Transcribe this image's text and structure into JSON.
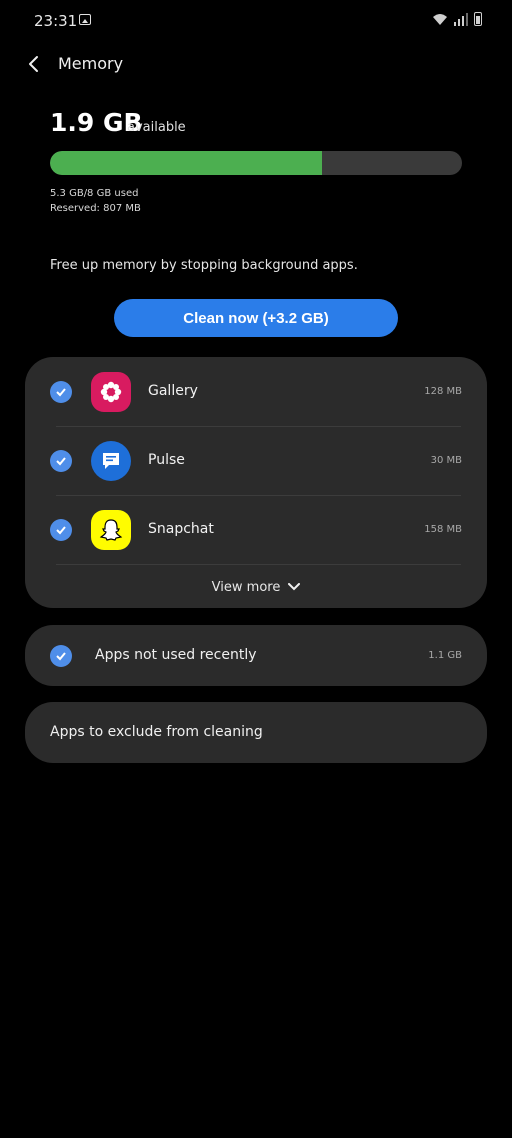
{
  "status_bar": {
    "time": "23:31"
  },
  "header": {
    "title": "Memory"
  },
  "memory": {
    "available_value": "1.9 GB",
    "available_label": "available",
    "used_fraction": 0.66,
    "used_text": "5.3 GB/8 GB used",
    "reserved_text": "Reserved: 807 MB"
  },
  "hint": "Free up memory by stopping background apps.",
  "clean_button": "Clean now (+3.2 GB)",
  "apps": [
    {
      "name": "Gallery",
      "size": "128 MB",
      "checked": true,
      "icon": "gallery-icon",
      "color": "#d81b60"
    },
    {
      "name": "Pulse",
      "size": "30 MB",
      "checked": true,
      "icon": "pulse-icon",
      "color": "#1e6fd9"
    },
    {
      "name": "Snapchat",
      "size": "158 MB",
      "checked": true,
      "icon": "snapchat-icon",
      "color": "#fffc00"
    }
  ],
  "view_more": "View more",
  "unused": {
    "label": "Apps not used recently",
    "size": "1.1 GB",
    "checked": true
  },
  "exclude": {
    "label": "Apps to exclude from cleaning"
  },
  "colors": {
    "accent": "#2b7de9",
    "progress": "#4caf50",
    "check": "#4f8ee9"
  }
}
